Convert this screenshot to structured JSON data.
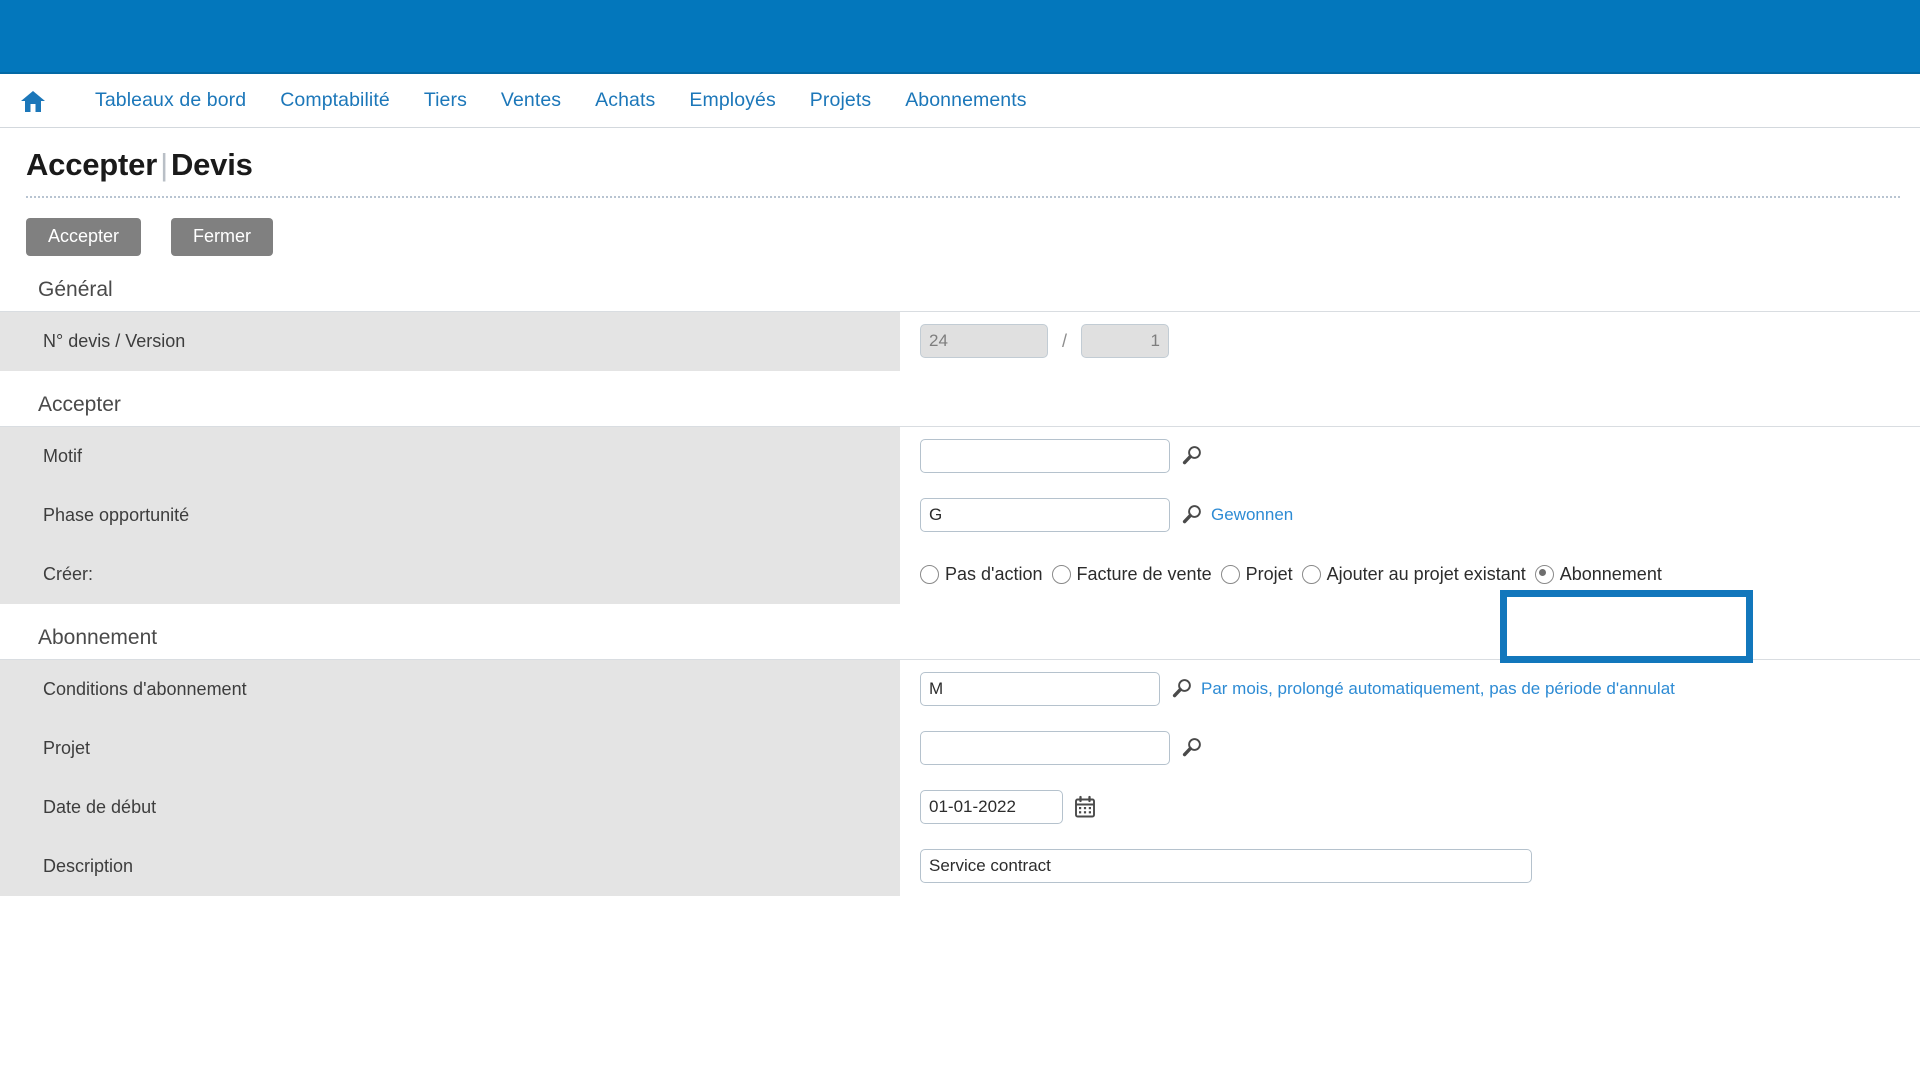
{
  "colors": {
    "brand_blue": "#0377bc",
    "link_blue": "#2d8bd4",
    "nav_blue": "#1c77b9",
    "button_gray": "#808080",
    "row_gray": "#e4e4e4",
    "highlight_blue": "#1277bc"
  },
  "topbar": {
    "label": ""
  },
  "nav": {
    "home_icon": "home-icon",
    "items": [
      {
        "label": "Tableaux de bord"
      },
      {
        "label": "Comptabilité"
      },
      {
        "label": "Tiers"
      },
      {
        "label": "Ventes"
      },
      {
        "label": "Achats"
      },
      {
        "label": "Employés"
      },
      {
        "label": "Projets"
      },
      {
        "label": "Abonnements"
      }
    ]
  },
  "page": {
    "title_primary": "Accepter",
    "title_separator": "|",
    "title_secondary": "Devis"
  },
  "toolbar": {
    "accept_label": "Accepter",
    "close_label": "Fermer"
  },
  "sections": {
    "general": {
      "title": "Général",
      "row_label": "N° devis / Version",
      "devis_value": "24",
      "separator": "/",
      "version_value": "1"
    },
    "accepter": {
      "title": "Accepter",
      "motif": {
        "label": "Motif",
        "value": "",
        "placeholder": "",
        "icon": "magnifier-icon"
      },
      "phase": {
        "label": "Phase opportunité",
        "value": "G",
        "icon": "magnifier-icon",
        "resolved_text": "Gewonnen"
      },
      "creer": {
        "label": "Créer:",
        "options": [
          {
            "label": "Pas d'action",
            "checked": false
          },
          {
            "label": "Facture de vente",
            "checked": false
          },
          {
            "label": "Projet",
            "checked": false
          },
          {
            "label": "Ajouter au projet existant",
            "checked": false
          },
          {
            "label": "Abonnement",
            "checked": true
          }
        ]
      }
    },
    "abonnement": {
      "title": "Abonnement",
      "conditions": {
        "label": "Conditions d'abonnement",
        "value": "M",
        "icon": "magnifier-icon",
        "resolved_text": "Par mois, prolongé automatiquement, pas de période d'annulat"
      },
      "projet": {
        "label": "Projet",
        "value": "",
        "icon": "magnifier-icon"
      },
      "date_debut": {
        "label": "Date de début",
        "value": "01-01-2022",
        "icon": "calendar-icon"
      },
      "description": {
        "label": "Description",
        "value": "Service contract"
      }
    }
  }
}
